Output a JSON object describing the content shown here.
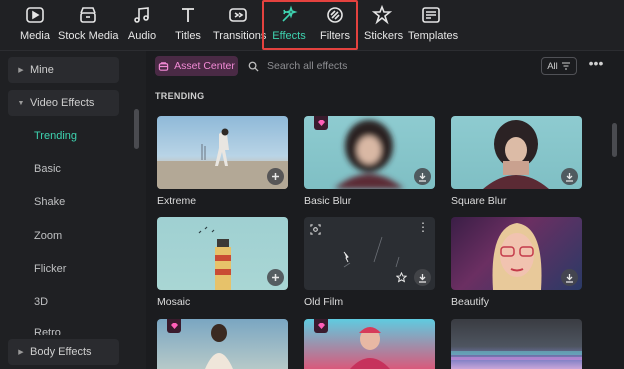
{
  "toolbar": {
    "items": [
      {
        "label": "Media",
        "icon": "media-icon"
      },
      {
        "label": "Stock Media",
        "icon": "stock-media-icon"
      },
      {
        "label": "Audio",
        "icon": "audio-icon"
      },
      {
        "label": "Titles",
        "icon": "titles-icon"
      },
      {
        "label": "Transitions",
        "icon": "transitions-icon"
      },
      {
        "label": "Effects",
        "icon": "effects-icon",
        "active": true
      },
      {
        "label": "Filters",
        "icon": "filters-icon"
      },
      {
        "label": "Stickers",
        "icon": "stickers-icon"
      },
      {
        "label": "Templates",
        "icon": "templates-icon"
      }
    ],
    "accent": "#3ed3b0",
    "highlight_color": "#e4423f"
  },
  "sidebar": {
    "groups": [
      {
        "label": "Mine",
        "expanded": false
      },
      {
        "label": "Video Effects",
        "expanded": true
      },
      {
        "label": "Body Effects",
        "expanded": false
      }
    ],
    "items": [
      "Trending",
      "Basic",
      "Shake",
      "Zoom",
      "Flicker",
      "3D",
      "Retro"
    ],
    "active_item": "Trending"
  },
  "header": {
    "asset_center": "Asset Center",
    "search_placeholder": "Search all effects",
    "filter_label": "All"
  },
  "section_title": "TRENDING",
  "cards": [
    {
      "label": "Extreme",
      "premium": false,
      "action": "add"
    },
    {
      "label": "Basic Blur",
      "premium": true,
      "action": "download"
    },
    {
      "label": "Square Blur",
      "premium": false,
      "action": "download"
    },
    {
      "label": "Mosaic",
      "premium": false,
      "action": "add"
    },
    {
      "label": "Old Film",
      "premium": false,
      "action": "download"
    },
    {
      "label": "Beautify",
      "premium": false,
      "action": "download"
    },
    {
      "label": "",
      "premium": true,
      "action": ""
    },
    {
      "label": "",
      "premium": true,
      "action": ""
    },
    {
      "label": "",
      "premium": false,
      "action": ""
    }
  ]
}
